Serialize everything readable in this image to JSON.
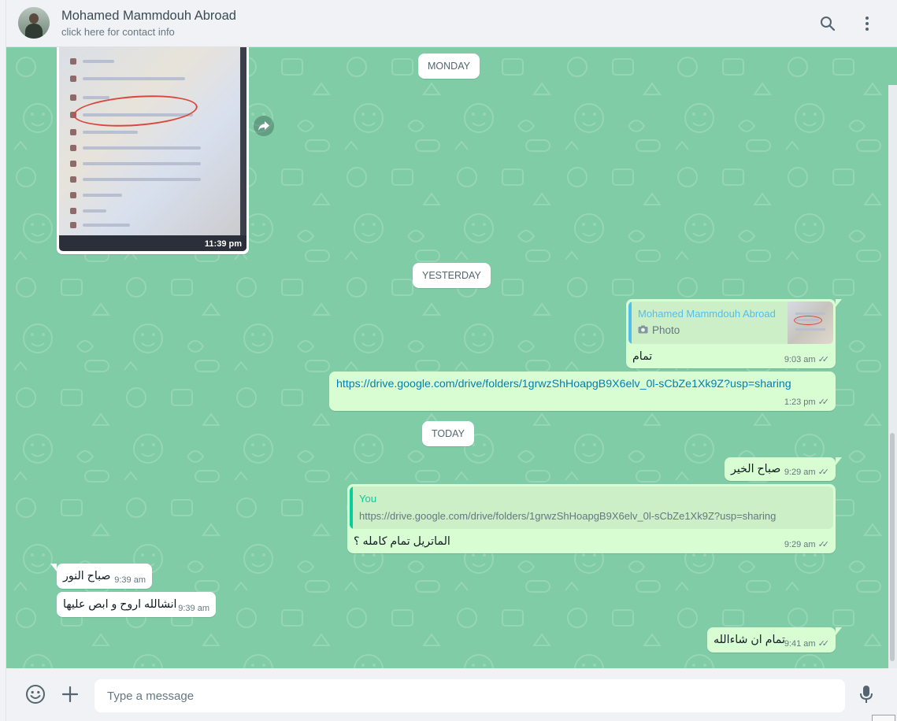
{
  "header": {
    "contact_name": "Mohamed Mammdouh Abroad",
    "contact_subtitle": "click here for contact info",
    "icons": [
      "search-icon",
      "menu-icon"
    ]
  },
  "colors": {
    "chat_background": "#7fcca6",
    "outgoing_bubble": "#d9fdd3",
    "incoming_bubble": "#ffffff",
    "link": "#027eb5",
    "quote_author_contact": "#53bdeb",
    "quote_author_self": "#06cf9c"
  },
  "chat": {
    "date_monday": "MONDAY",
    "date_yesterday": "YESTERDAY",
    "date_today": "TODAY",
    "photo_message": {
      "time": "11:39 pm"
    },
    "messages": [
      {
        "direction": "out",
        "quote_author": "Mohamed Mammdouh Abroad",
        "quote_text": "Photo",
        "text": "تمام",
        "time": "9:03 am"
      },
      {
        "direction": "out",
        "text": "https://drive.google.com/drive/folders/1grwzShHoapgB9X6elv_0l-sCbZe1Xk9Z?usp=sharing",
        "time": "1:23 pm"
      },
      {
        "direction": "out",
        "text": "صباح الخير",
        "time": "9:29 am"
      },
      {
        "direction": "out",
        "quote_author": "You",
        "quote_text": "https://drive.google.com/drive/folders/1grwzShHoapgB9X6elv_0l-sCbZe1Xk9Z?usp=sharing",
        "text": "الماتريل تمام كامله ؟",
        "time": "9:29 am"
      },
      {
        "direction": "in",
        "text": "صباح النور",
        "time": "9:39 am"
      },
      {
        "direction": "in",
        "text": "انشالله اروح و ابص عليها",
        "time": "9:39 am"
      },
      {
        "direction": "out",
        "text": "تمام ان شاءالله",
        "time": "9:41 am"
      }
    ]
  },
  "footer": {
    "placeholder": "Type a message",
    "icons": [
      "emoji-icon",
      "attach-icon",
      "microphone-icon"
    ]
  }
}
